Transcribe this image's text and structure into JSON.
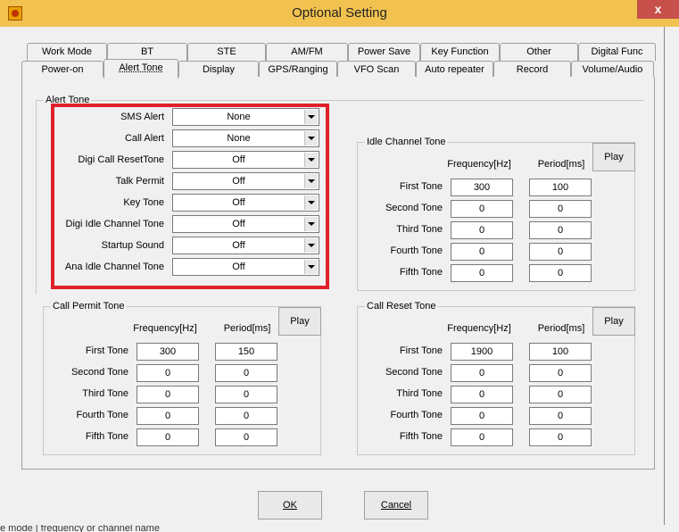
{
  "window": {
    "title": "Optional Setting",
    "close_label": "x"
  },
  "tabs_row1": [
    "Work Mode",
    "BT",
    "STE",
    "AM/FM",
    "Power Save",
    "Key Function",
    "Other",
    "Digital Func"
  ],
  "tabs_row2": [
    "Power-on",
    "Alert Tone",
    "Display",
    "GPS/Ranging",
    "VFO Scan",
    "Auto repeater",
    "Record",
    "Volume/Audio"
  ],
  "active_tab": "Alert Tone",
  "alert_tone": {
    "group_title": "Alert Tone",
    "rows": [
      {
        "label": "SMS Alert",
        "value": "None"
      },
      {
        "label": "Call Alert",
        "value": "None"
      },
      {
        "label": "Digi Call ResetTone",
        "value": "Off"
      },
      {
        "label": "Talk Permit",
        "value": "Off"
      },
      {
        "label": "Key Tone",
        "value": "Off"
      },
      {
        "label": "Digi Idle Channel Tone",
        "value": "Off"
      },
      {
        "label": "Startup Sound",
        "value": "Off"
      },
      {
        "label": "Ana Idle Channel Tone",
        "value": "Off"
      }
    ]
  },
  "idle_channel_tone": {
    "title": "Idle Channel Tone",
    "freq_header": "Frequency[Hz]",
    "period_header": "Period[ms]",
    "play_label": "Play",
    "rows": [
      {
        "label": "First Tone",
        "freq": "300",
        "period": "100"
      },
      {
        "label": "Second Tone",
        "freq": "0",
        "period": "0"
      },
      {
        "label": "Third Tone",
        "freq": "0",
        "period": "0"
      },
      {
        "label": "Fourth Tone",
        "freq": "0",
        "period": "0"
      },
      {
        "label": "Fifth Tone",
        "freq": "0",
        "period": "0"
      }
    ]
  },
  "call_permit_tone": {
    "title": "Call Permit Tone",
    "freq_header": "Frequency[Hz]",
    "period_header": "Period[ms]",
    "play_label": "Play",
    "rows": [
      {
        "label": "First Tone",
        "freq": "300",
        "period": "150"
      },
      {
        "label": "Second Tone",
        "freq": "0",
        "period": "0"
      },
      {
        "label": "Third Tone",
        "freq": "0",
        "period": "0"
      },
      {
        "label": "Fourth Tone",
        "freq": "0",
        "period": "0"
      },
      {
        "label": "Fifth Tone",
        "freq": "0",
        "period": "0"
      }
    ]
  },
  "call_reset_tone": {
    "title": "Call Reset Tone",
    "freq_header": "Frequency[Hz]",
    "period_header": "Period[ms]",
    "play_label": "Play",
    "rows": [
      {
        "label": "First Tone",
        "freq": "1900",
        "period": "100"
      },
      {
        "label": "Second Tone",
        "freq": "0",
        "period": "0"
      },
      {
        "label": "Third Tone",
        "freq": "0",
        "period": "0"
      },
      {
        "label": "Fourth Tone",
        "freq": "0",
        "period": "0"
      },
      {
        "label": "Fifth Tone",
        "freq": "0",
        "period": "0"
      }
    ]
  },
  "buttons": {
    "ok": "OK",
    "cancel": "Cancel"
  },
  "status_text": "e mode  |  frequency or channel name",
  "colors": {
    "titlebar": "#f2c250",
    "close_button": "#c7504b",
    "highlight_border": "#e0202a"
  }
}
